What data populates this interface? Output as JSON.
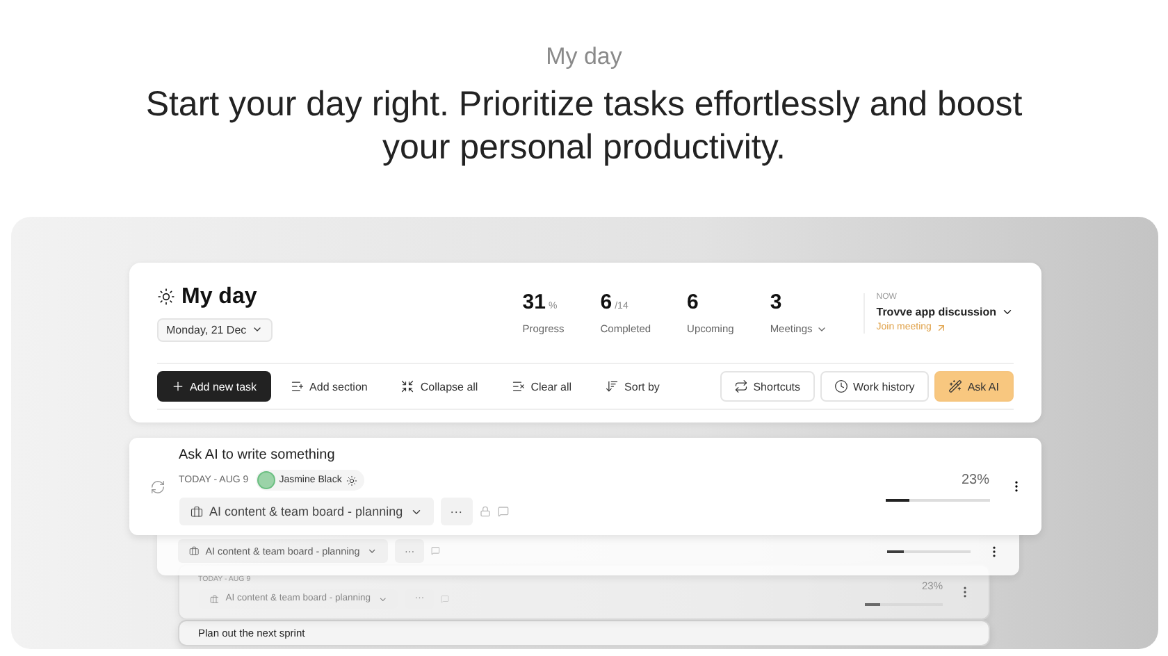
{
  "header": {
    "eyebrow": "My day",
    "headline": "Start your day right. Prioritize tasks effortlessly and boost your personal productivity."
  },
  "dashboard": {
    "title": "My day",
    "date": "Monday, 21 Dec",
    "stats": [
      {
        "value": "31",
        "unit": "%",
        "label": "Progress",
        "dropdown": false
      },
      {
        "value": "6",
        "unit": "/14",
        "label": "Completed",
        "dropdown": false
      },
      {
        "value": "6",
        "label": "Upcoming",
        "dropdown": false
      },
      {
        "value": "3",
        "label": "Meetings",
        "dropdown": true
      }
    ],
    "now": {
      "label": "NOW",
      "title": "Trovve app discussion",
      "link": "Join meeting"
    },
    "actions": [
      {
        "label": "Add new task",
        "kind": "primary"
      },
      {
        "label": "Add section",
        "kind": "section"
      },
      {
        "label": "Collapse all",
        "kind": "collapse"
      },
      {
        "label": "Clear all",
        "kind": "clear"
      },
      {
        "label": "Sort by",
        "kind": "sort"
      }
    ],
    "right_actions": [
      {
        "label": "Shortcuts",
        "kind": "shortcuts"
      },
      {
        "label": "Work history",
        "kind": "history"
      },
      {
        "label": "Ask AI",
        "kind": "ai"
      }
    ]
  },
  "tasks": [
    {
      "title": "Ask AI to write something",
      "date": "TODAY - AUG 9",
      "assignee": "Jasmine Black",
      "project": "AI content & team board - planning",
      "more": "···",
      "percent": "23%",
      "level": 0.23
    },
    {
      "project": "AI content & team board - planning",
      "more": "···",
      "level": 0.2
    },
    {
      "date": "TODAY - AUG 9",
      "project": "AI content & team board - planning",
      "more": "···",
      "percent": "23%",
      "level": 0.2
    },
    {
      "title": "Plan out the next sprint"
    }
  ]
}
